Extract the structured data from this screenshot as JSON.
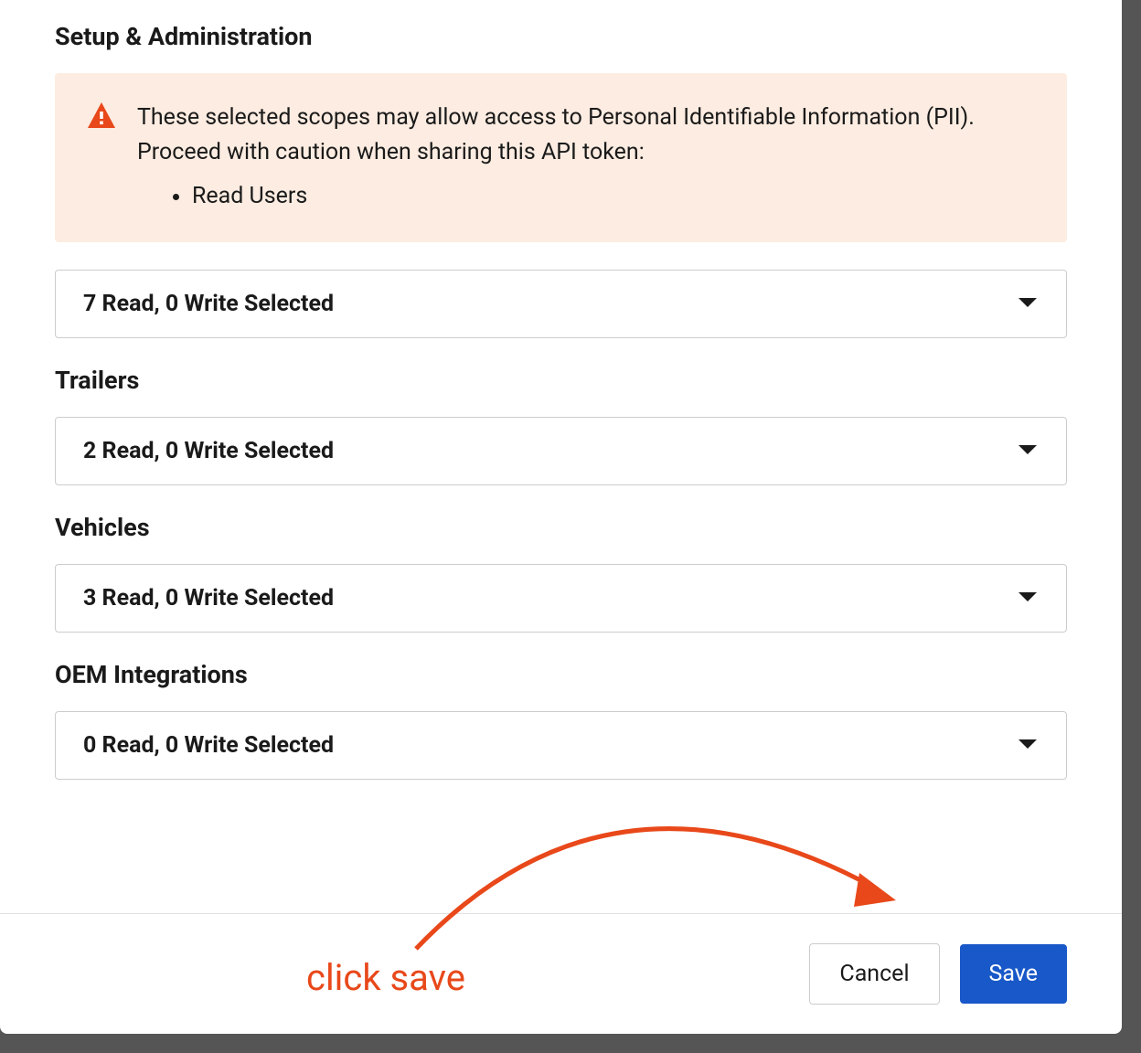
{
  "sections": {
    "setup": {
      "title": "Setup & Administration",
      "dropdown_label": "7 Read, 0 Write Selected"
    },
    "trailers": {
      "title": "Trailers",
      "dropdown_label": "2 Read, 0 Write Selected"
    },
    "vehicles": {
      "title": "Vehicles",
      "dropdown_label": "3 Read, 0 Write Selected"
    },
    "oem": {
      "title": "OEM Integrations",
      "dropdown_label": "0 Read, 0 Write Selected"
    }
  },
  "warning": {
    "text": "These selected scopes may allow access to Personal Identifiable Information (PII). Proceed with caution when sharing this API token:",
    "items": [
      "Read Users"
    ]
  },
  "footer": {
    "cancel_label": "Cancel",
    "save_label": "Save"
  },
  "annotation": {
    "text": "click save",
    "color": "#e8481a"
  }
}
